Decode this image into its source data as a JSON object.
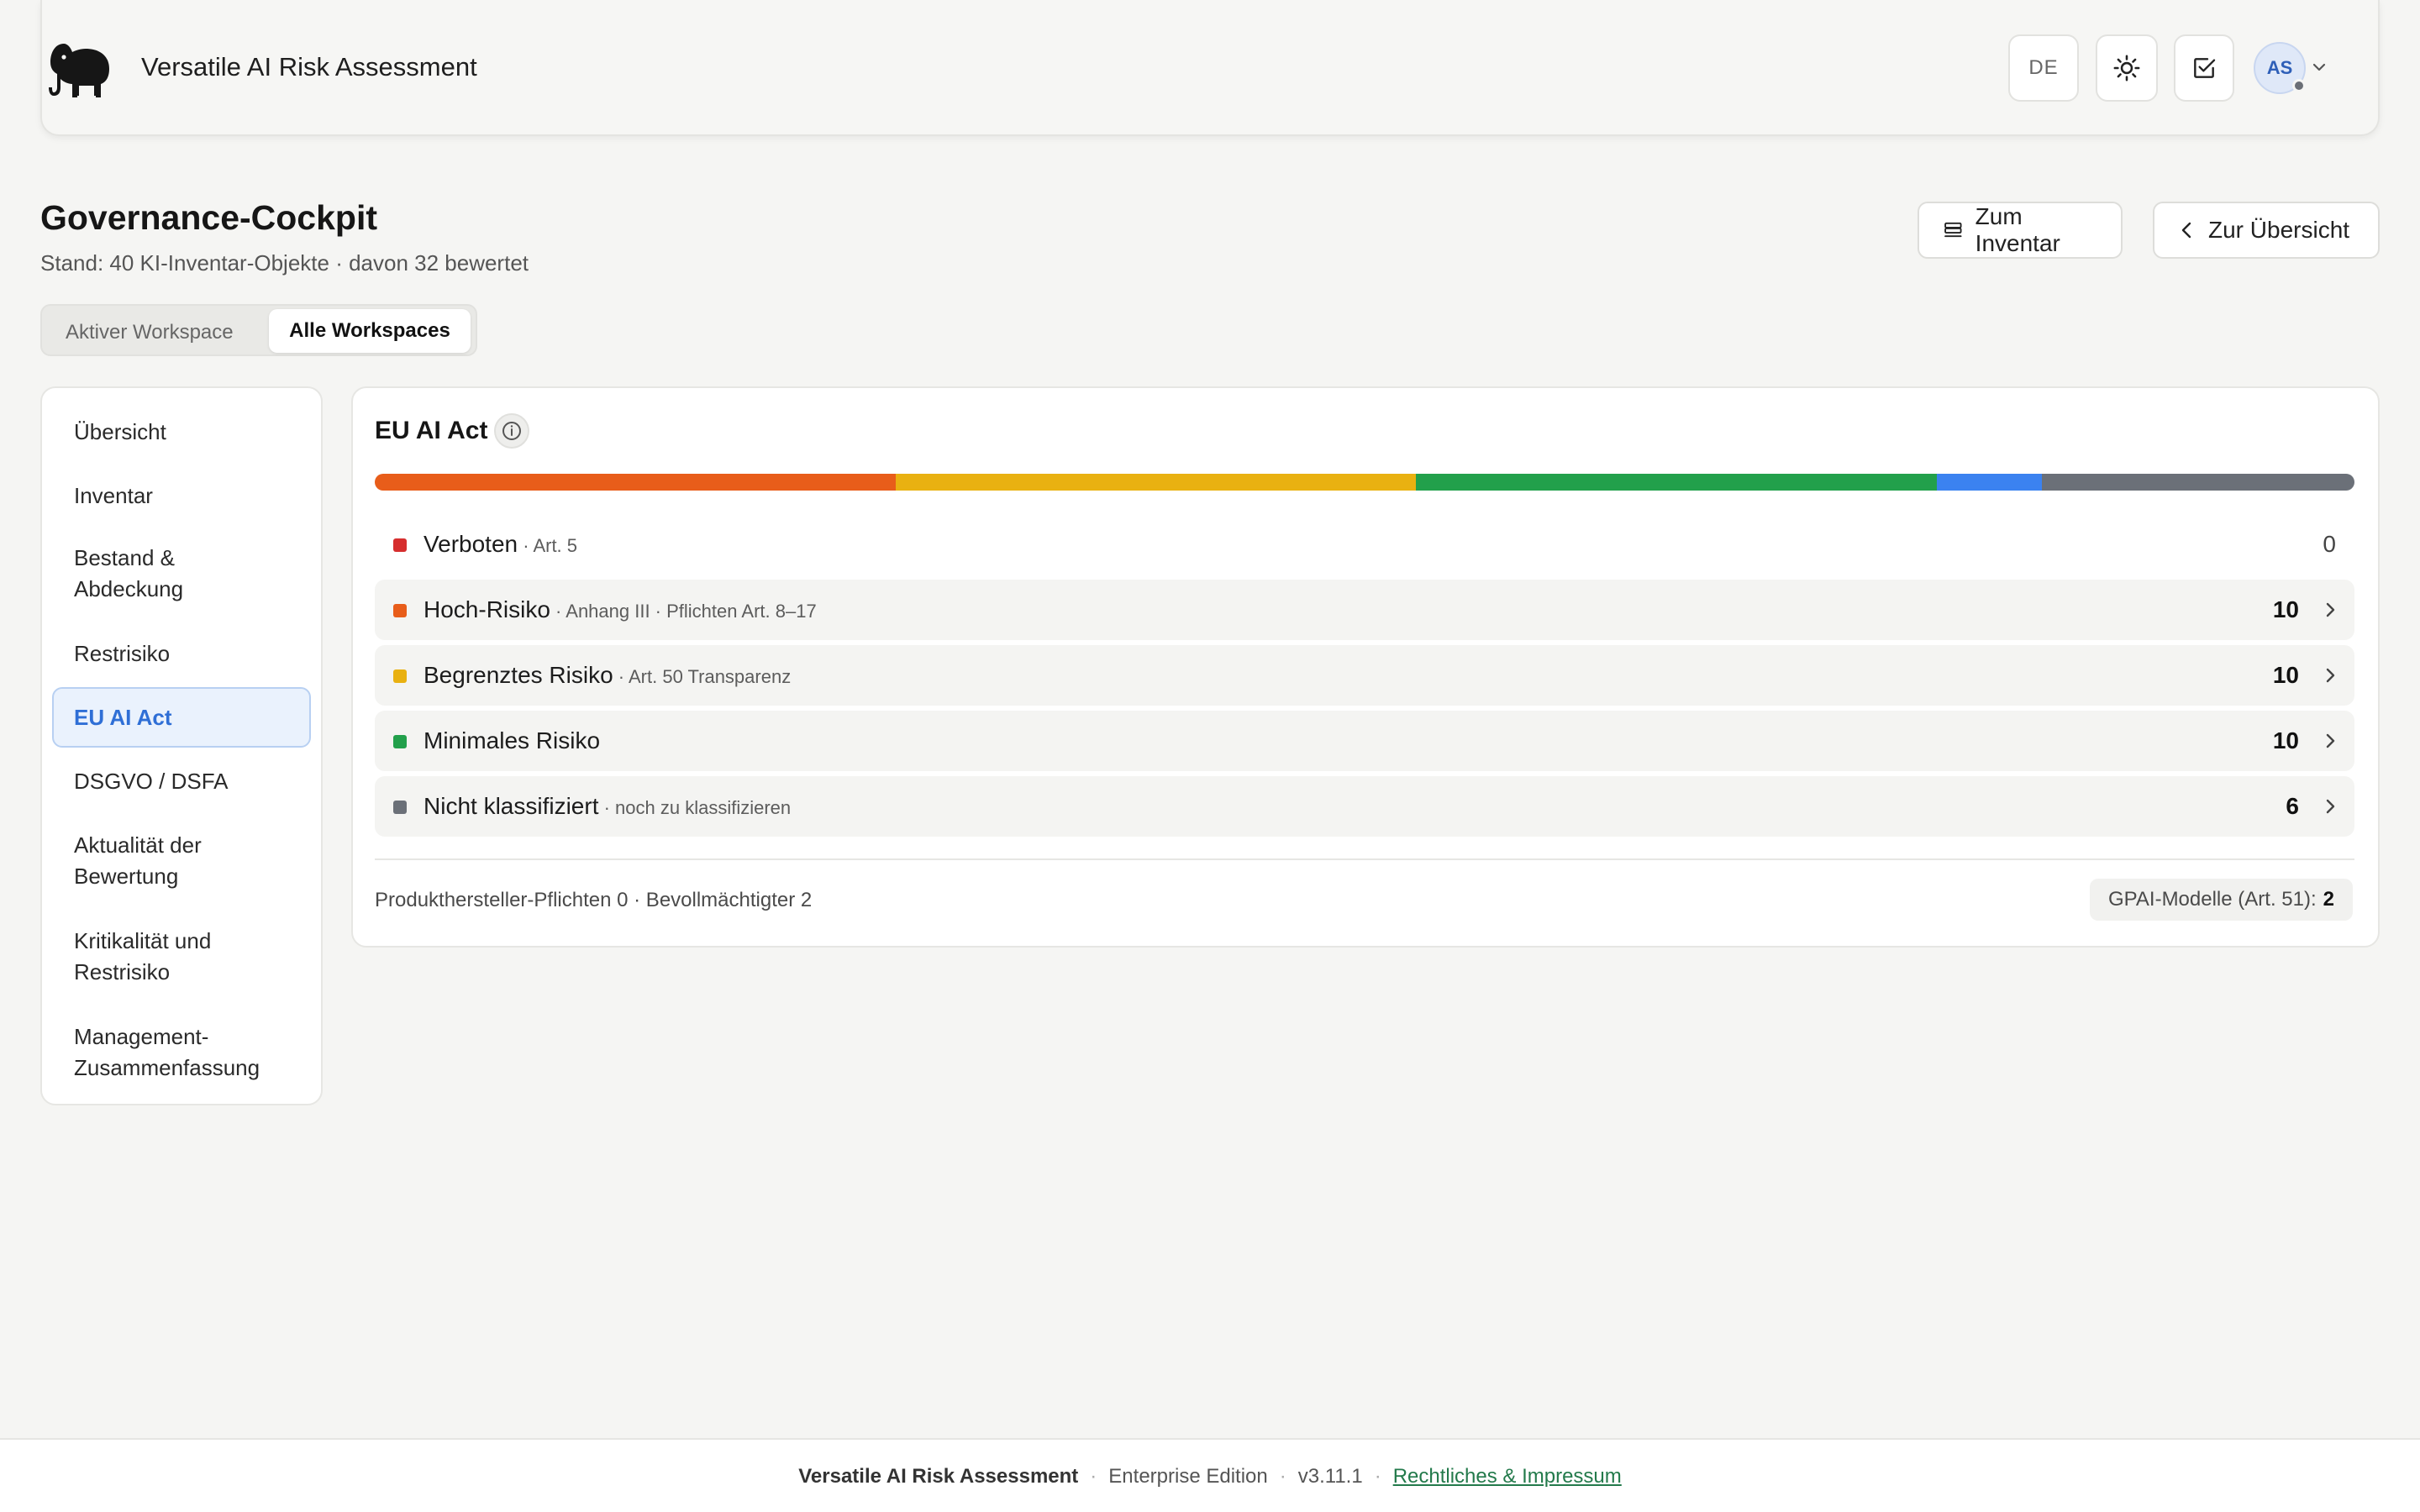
{
  "header": {
    "app_title": "Versatile AI Risk Assessment",
    "lang": "DE",
    "avatar": "AS",
    "icons": [
      "elephant-logo-icon",
      "sun-icon",
      "checkbox-icon",
      "chevron-down-icon"
    ]
  },
  "page": {
    "title": "Governance-Cockpit",
    "subtitle": "Stand: 40 KI-Inventar-Objekte · davon 32 bewertet",
    "btn_inventory": "Zum Inventar",
    "btn_overview": "Zur Übersicht"
  },
  "workspace": {
    "option_active": "Aktiver Workspace",
    "option_all": "Alle Workspaces",
    "selected": "Alle Workspaces"
  },
  "sidebar": {
    "items": [
      {
        "line1": "Übersicht",
        "line2": ""
      },
      {
        "line1": "Inventar",
        "line2": ""
      },
      {
        "line1": "Bestand &",
        "line2": "Abdeckung"
      },
      {
        "line1": "Restrisiko",
        "line2": ""
      },
      {
        "line1": "EU AI Act",
        "line2": ""
      },
      {
        "line1": "DSGVO / DSFA",
        "line2": ""
      },
      {
        "line1": "Aktualität der",
        "line2": "Bewertung"
      },
      {
        "line1": "Kritikalität und",
        "line2": "Restrisiko"
      },
      {
        "line1": "Management-",
        "line2": "Zusammenfassung"
      }
    ],
    "active": "EU AI Act"
  },
  "card": {
    "title": "EU AI Act",
    "distribution": [
      {
        "name": "Hoch-Risiko",
        "share": 0.263,
        "color": "#e85d1a"
      },
      {
        "name": "Begrenztes Risiko",
        "share": 0.263,
        "color": "#e9b111"
      },
      {
        "name": "Minimales Risiko",
        "share": 0.263,
        "color": "#22a04b"
      },
      {
        "name": "GPAI",
        "share": 0.053,
        "color": "#3b82f0"
      },
      {
        "name": "Nicht klassifiziert",
        "share": 0.158,
        "color": "#6b7078"
      }
    ],
    "rows": [
      {
        "label": "Verboten",
        "sub": " · Art. 5",
        "count": "0",
        "color": "#d62e2e"
      },
      {
        "label": "Hoch-Risiko",
        "sub": " · Anhang III · Pflichten Art. 8–17",
        "count": "10",
        "color": "#e85d1a"
      },
      {
        "label": "Begrenztes Risiko",
        "sub": " · Art. 50 Transparenz",
        "count": "10",
        "color": "#e9b111"
      },
      {
        "label": "Minimales Risiko",
        "sub": "",
        "count": "10",
        "color": "#22a04b"
      },
      {
        "label": "Nicht klassifiziert",
        "sub": " · noch zu klassifizieren",
        "count": "6",
        "color": "#6b7078"
      }
    ],
    "footer_left": "Produkthersteller-Pflichten 0 · Bevollmächtigter 2",
    "gpai_label": "GPAI-Modelle (Art. 51):",
    "gpai_value": "2"
  },
  "footer": {
    "brand": "Versatile AI Risk Assessment",
    "edition": "Enterprise Edition",
    "version": "v3.11.1",
    "link": "Rechtliches & Impressum"
  }
}
